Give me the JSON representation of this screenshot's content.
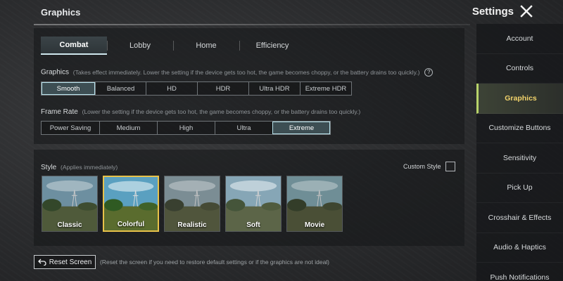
{
  "header": {
    "title": "Graphics",
    "settings_title": "Settings"
  },
  "tabs": [
    {
      "label": "Combat",
      "active": true
    },
    {
      "label": "Lobby"
    },
    {
      "label": "Home"
    },
    {
      "label": "Efficiency"
    }
  ],
  "graphics": {
    "label": "Graphics",
    "note": "(Takes effect immediately. Lower the setting if the device gets too hot, the game becomes choppy, or the battery drains too quickly.)",
    "help": "?",
    "options": [
      "Smooth",
      "Balanced",
      "HD",
      "HDR",
      "Ultra HDR",
      "Extreme HDR"
    ],
    "selected": "Smooth"
  },
  "frame_rate": {
    "label": "Frame Rate",
    "note": "(Lower the setting if the device gets too hot, the game becomes choppy, or the battery drains too quickly.)",
    "options": [
      "Power Saving",
      "Medium",
      "High",
      "Ultra",
      "Extreme"
    ],
    "selected": "Extreme"
  },
  "style": {
    "label": "Style",
    "note": "(Applies immediately)",
    "custom_label": "Custom Style",
    "custom_checked": false,
    "options": [
      {
        "label": "Classic",
        "tint": "#5f7b86"
      },
      {
        "label": "Colorful",
        "tint": "#4f8a9c"
      },
      {
        "label": "Realistic",
        "tint": "#6a767a"
      },
      {
        "label": "Soft",
        "tint": "#7a8f98"
      },
      {
        "label": "Movie",
        "tint": "#5d6f73"
      }
    ],
    "selected": "Colorful"
  },
  "reset": {
    "label": "Reset Screen",
    "note": "(Reset the screen if you need to restore default settings or if the graphics are not ideal)"
  },
  "sidebar": {
    "items": [
      {
        "label": "Account"
      },
      {
        "label": "Controls"
      },
      {
        "label": "Graphics",
        "active": true
      },
      {
        "label": "Customize Buttons"
      },
      {
        "label": "Sensitivity"
      },
      {
        "label": "Pick Up"
      },
      {
        "label": "Crosshair & Effects"
      },
      {
        "label": "Audio & Haptics"
      },
      {
        "label": "Push Notifications"
      }
    ]
  },
  "colors": {
    "accent_select": "#b9e3ec",
    "accent_style": "#e8c24a",
    "sidebar_active_text": "#f2d36b"
  }
}
